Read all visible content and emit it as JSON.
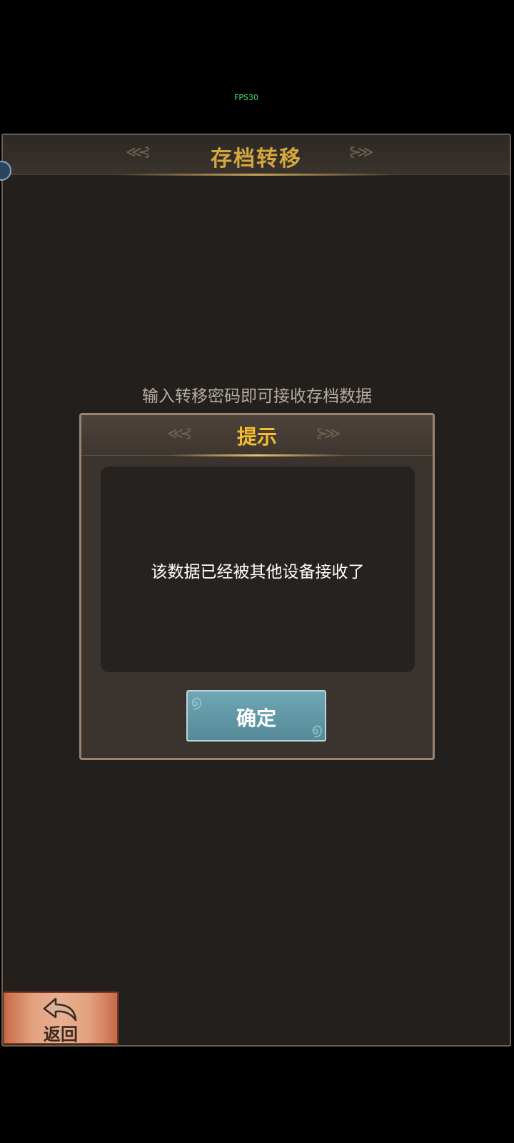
{
  "status": {
    "fps": "FPS30"
  },
  "screen": {
    "title": "存档转移",
    "instruction": "输入转移密码即可接收存档数据"
  },
  "dialog": {
    "title": "提示",
    "message": "该数据已经被其他设备接收了",
    "confirm_label": "确定"
  },
  "footer": {
    "back_label": "返回"
  },
  "colors": {
    "panel_bg": "#221f1c",
    "title_gold": "#d6a73e",
    "dialog_title": "#f5bd2c",
    "confirm_button": "#6fa7b4",
    "back_button": "#e3a27f"
  }
}
